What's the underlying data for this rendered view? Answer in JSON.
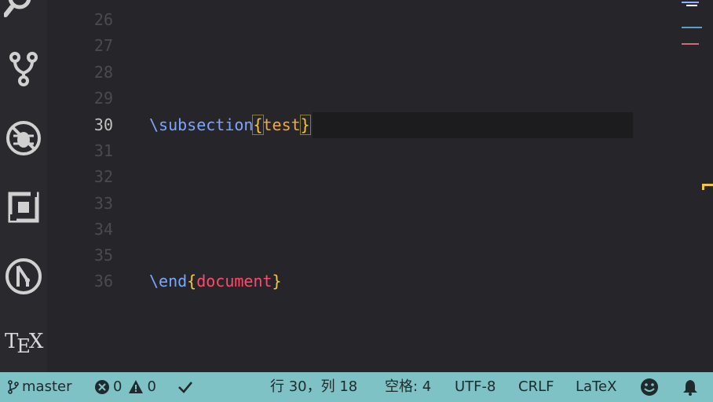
{
  "activity_bar": {
    "icons": [
      "search-icon",
      "source-control-icon",
      "debug-icon",
      "extensions-icon",
      "git-graph-icon"
    ],
    "tex_logo": "TEX"
  },
  "editor": {
    "lines": [
      {
        "number": "26",
        "code": ""
      },
      {
        "number": "27",
        "code": ""
      },
      {
        "number": "28",
        "code": ""
      },
      {
        "number": "29",
        "code": ""
      },
      {
        "number": "30",
        "code": "\\subsection{test}",
        "current": true
      },
      {
        "number": "31",
        "code": ""
      },
      {
        "number": "32",
        "code": ""
      },
      {
        "number": "33",
        "code": ""
      },
      {
        "number": "34",
        "code": ""
      },
      {
        "number": "35",
        "code": ""
      },
      {
        "number": "36",
        "code": "\\end{document}"
      }
    ],
    "line30": {
      "command": "\\subsection",
      "open": "{",
      "arg": "test",
      "close": "}"
    },
    "line36": {
      "command": "\\end",
      "open": "{",
      "arg": "document",
      "close": "}"
    }
  },
  "statusbar": {
    "branch": "master",
    "errors": "0",
    "warnings": "0",
    "position": "行 30，列 18",
    "indent": "空格: 4",
    "encoding": "UTF-8",
    "eol": "CRLF",
    "language": "LaTeX"
  },
  "colors": {
    "statusbar_bg": "#7ec2c6",
    "command": "#7aa6ff",
    "brace": "#f4c542",
    "document_arg": "#ff4a6a"
  }
}
